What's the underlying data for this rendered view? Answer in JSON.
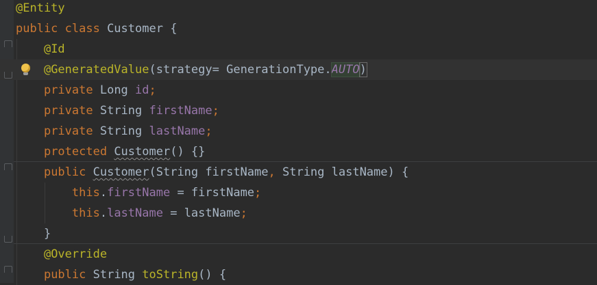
{
  "editor": {
    "lines": [
      {
        "segments": [
          {
            "t": "@Entity",
            "c": "ann"
          }
        ]
      },
      {
        "segments": [
          {
            "t": "public class ",
            "c": "kw"
          },
          {
            "t": "Customer ",
            "c": "id"
          },
          {
            "t": "{",
            "c": "id"
          }
        ]
      },
      {
        "segments": [
          {
            "t": "    ",
            "c": "id"
          },
          {
            "t": "@Id",
            "c": "ann"
          }
        ]
      },
      {
        "segments": [
          {
            "t": "    ",
            "c": "id"
          },
          {
            "t": "@GeneratedValue",
            "c": "ann"
          },
          {
            "t": "(",
            "c": "id"
          },
          {
            "t": "strategy",
            "c": "id"
          },
          {
            "t": "= ",
            "c": "id"
          },
          {
            "t": "GenerationType.",
            "c": "id"
          },
          {
            "t": "AUTO",
            "c": "ital hl"
          },
          {
            "t": ")",
            "c": "id paren-match"
          }
        ]
      },
      {
        "segments": [
          {
            "t": "    ",
            "c": "id"
          },
          {
            "t": "private ",
            "c": "kw"
          },
          {
            "t": "Long ",
            "c": "id"
          },
          {
            "t": "id",
            "c": "fld"
          },
          {
            "t": ";",
            "c": "punc"
          }
        ]
      },
      {
        "segments": [
          {
            "t": "    ",
            "c": "id"
          },
          {
            "t": "private ",
            "c": "kw"
          },
          {
            "t": "String ",
            "c": "id"
          },
          {
            "t": "firstName",
            "c": "fld"
          },
          {
            "t": ";",
            "c": "punc"
          }
        ]
      },
      {
        "segments": [
          {
            "t": "    ",
            "c": "id"
          },
          {
            "t": "private ",
            "c": "kw"
          },
          {
            "t": "String ",
            "c": "id"
          },
          {
            "t": "lastName",
            "c": "fld"
          },
          {
            "t": ";",
            "c": "punc"
          }
        ]
      },
      {
        "segments": [
          {
            "t": "    ",
            "c": "id"
          },
          {
            "t": "protected ",
            "c": "kw"
          },
          {
            "t": "Customer",
            "c": "id squig"
          },
          {
            "t": "() ",
            "c": "id"
          },
          {
            "t": "{}",
            "c": "id"
          }
        ]
      },
      {
        "segments": [
          {
            "t": "    ",
            "c": "id"
          },
          {
            "t": "public ",
            "c": "kw"
          },
          {
            "t": "Customer",
            "c": "id squig"
          },
          {
            "t": "(String firstName",
            "c": "id"
          },
          {
            "t": ", ",
            "c": "punc"
          },
          {
            "t": "String lastName) {",
            "c": "id"
          }
        ]
      },
      {
        "segments": [
          {
            "t": "        ",
            "c": "id"
          },
          {
            "t": "this",
            "c": "kw"
          },
          {
            "t": ".",
            "c": "id"
          },
          {
            "t": "firstName",
            "c": "fld"
          },
          {
            "t": " = firstName",
            "c": "id"
          },
          {
            "t": ";",
            "c": "punc"
          }
        ]
      },
      {
        "segments": [
          {
            "t": "        ",
            "c": "id"
          },
          {
            "t": "this",
            "c": "kw"
          },
          {
            "t": ".",
            "c": "id"
          },
          {
            "t": "lastName",
            "c": "fld"
          },
          {
            "t": " = lastName",
            "c": "id"
          },
          {
            "t": ";",
            "c": "punc"
          }
        ]
      },
      {
        "segments": [
          {
            "t": "    }",
            "c": "id"
          }
        ]
      },
      {
        "segments": [
          {
            "t": "    ",
            "c": "id"
          },
          {
            "t": "@Override",
            "c": "ann"
          }
        ]
      },
      {
        "segments": [
          {
            "t": "    ",
            "c": "id"
          },
          {
            "t": "public ",
            "c": "kw"
          },
          {
            "t": "String ",
            "c": "id"
          },
          {
            "t": "toString",
            "c": "ann"
          },
          {
            "t": "() {",
            "c": "id"
          }
        ]
      }
    ],
    "current_line": 3,
    "fold_open_lines": [
      2,
      8,
      13
    ],
    "fold_close_lines": [
      3,
      11
    ],
    "method_separator_after_lines": [
      7,
      11
    ],
    "intention_bulb_line": 3,
    "intention_icon": "lightbulb-icon"
  }
}
